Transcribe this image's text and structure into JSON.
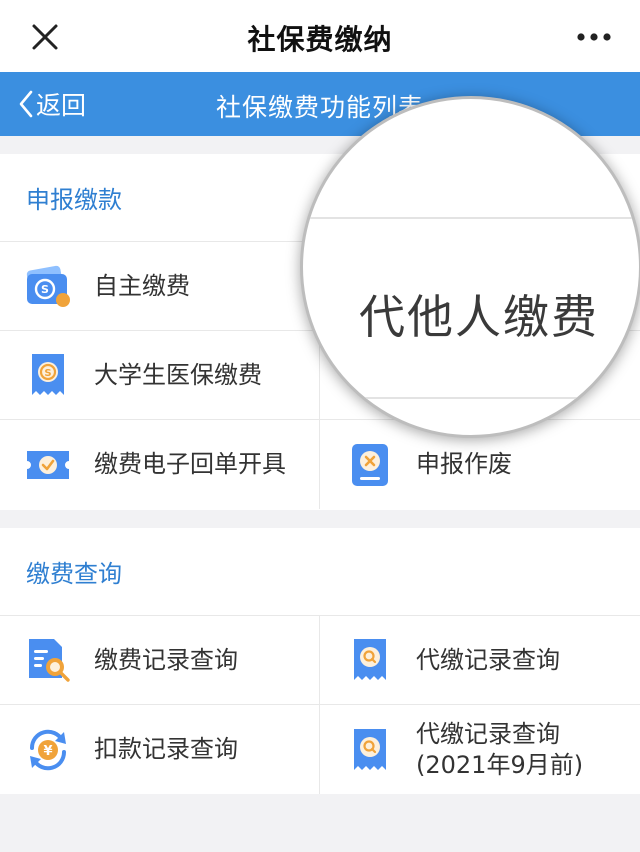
{
  "topbar": {
    "title": "社保费缴纳",
    "close_icon": "close-icon",
    "more_icon": "more-dots-icon"
  },
  "navbar": {
    "back_label": "返回",
    "title": "社保缴费功能列表",
    "color": "#3b8fe0"
  },
  "magnifier": {
    "text": "代他人缴费"
  },
  "sections": [
    {
      "title": "申报缴款",
      "items": [
        {
          "label": "自主缴费",
          "icon": "wallet-icon"
        },
        {
          "label": "",
          "icon": ""
        },
        {
          "label": "大学生医保缴费",
          "icon": "receipt-icon"
        },
        {
          "label": "",
          "icon": ""
        },
        {
          "label": "缴费电子回单开具",
          "icon": "ticket-check-icon"
        },
        {
          "label": "申报作废",
          "icon": "void-document-icon"
        }
      ]
    },
    {
      "title": "缴费查询",
      "items": [
        {
          "label": "缴费记录查询",
          "icon": "document-search-icon"
        },
        {
          "label": "代缴记录查询",
          "icon": "receipt-search-icon"
        },
        {
          "label": "扣款记录查询",
          "icon": "yuan-refresh-icon"
        },
        {
          "label": "代缴记录查询(2021年9月前)",
          "icon": "receipt-search-icon"
        }
      ]
    }
  ],
  "colors": {
    "accent": "#2f7fd1",
    "icon_blue": "#4a8ef0",
    "icon_orange": "#f0a33a"
  }
}
